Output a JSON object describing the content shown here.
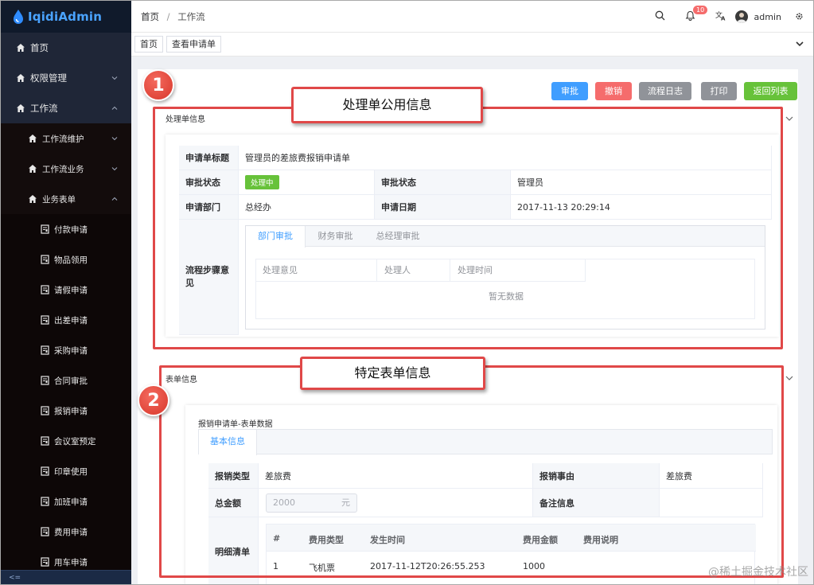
{
  "app": {
    "name": "IqidiAdmin"
  },
  "sidebar": {
    "items": [
      {
        "label": "首页",
        "icon": "home-icon"
      },
      {
        "label": "权限管理",
        "icon": "home-icon",
        "expandable": true
      },
      {
        "label": "工作流",
        "icon": "home-icon",
        "expanded": true
      },
      {
        "label": "工作流维护",
        "icon": "home-icon",
        "expandable": true
      },
      {
        "label": "工作流业务",
        "icon": "home-icon",
        "expandable": true
      },
      {
        "label": "业务表单",
        "icon": "home-icon",
        "expanded": true
      },
      {
        "label": "付款申请",
        "icon": "form-icon"
      },
      {
        "label": "物品领用",
        "icon": "form-icon"
      },
      {
        "label": "请假申请",
        "icon": "form-icon"
      },
      {
        "label": "出差申请",
        "icon": "form-icon"
      },
      {
        "label": "采购申请",
        "icon": "form-icon"
      },
      {
        "label": "合同审批",
        "icon": "form-icon"
      },
      {
        "label": "报销申请",
        "icon": "form-icon"
      },
      {
        "label": "会议室预定",
        "icon": "form-icon"
      },
      {
        "label": "印章使用",
        "icon": "form-icon"
      },
      {
        "label": "加班申请",
        "icon": "form-icon"
      },
      {
        "label": "费用申请",
        "icon": "form-icon"
      },
      {
        "label": "用车申请",
        "icon": "form-icon"
      }
    ],
    "collapse_label": "<="
  },
  "header": {
    "breadcrumb": [
      "首页",
      "工作流"
    ],
    "breadcrumb_sep": "/",
    "notification_count": "10",
    "user": "admin"
  },
  "tags": [
    "首页",
    "查看申请单"
  ],
  "toolbar": {
    "buttons": [
      {
        "label": "审批",
        "color": "#409eff"
      },
      {
        "label": "撤销",
        "color": "#f56c6c"
      },
      {
        "label": "流程日志",
        "color": "#909399"
      },
      {
        "label": "打印",
        "color": "#909399"
      },
      {
        "label": "返回列表",
        "color": "#67c23a"
      }
    ]
  },
  "common_info": {
    "section_title": "处理单信息",
    "title_label": "申请单标题",
    "title_value": "管理员的差旅费报销申请单",
    "status_label": "审批状态",
    "status_value": "处理中",
    "status2_label": "审批状态",
    "status2_value": "管理员",
    "dept_label": "申请部门",
    "dept_value": "总经办",
    "date_label": "申请日期",
    "date_value": "2017-11-13 20:29:14",
    "steps_label": "流程步骤意见",
    "tabs": [
      "部门审批",
      "财务审批",
      "总经理审批"
    ],
    "columns": [
      "处理意见",
      "处理人",
      "处理时间"
    ],
    "empty_text": "暂无数据"
  },
  "form_info": {
    "section_title": "表单信息",
    "panel_title": "报销申请单-表单数据",
    "tab": "基本信息",
    "type_label": "报销类型",
    "type_value": "差旅费",
    "reason_label": "报销事由",
    "reason_value": "差旅费",
    "amount_label": "总金额",
    "amount_value": "2000",
    "amount_unit": "元",
    "remark_label": "备注信息",
    "detail_label": "明细清单",
    "detail_columns": [
      "#",
      "费用类型",
      "发生时间",
      "费用金额",
      "费用说明"
    ],
    "detail_rows": [
      [
        "1",
        "飞机票",
        "2017-11-12T20:26:55.253",
        "1000",
        ""
      ]
    ]
  },
  "annotations": {
    "label1": "处理单公用信息",
    "num1": "1",
    "label2": "特定表单信息",
    "num2": "2",
    "color": "#e04848"
  },
  "watermark": "@稀土掘金技术社区"
}
